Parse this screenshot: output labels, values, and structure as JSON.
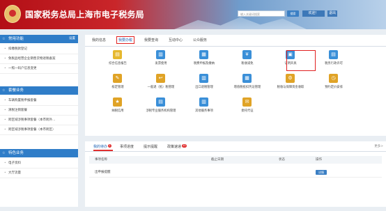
{
  "header": {
    "title": "国家税务总局上海市电子税务局",
    "search_placeholder": "输入关键词搜索",
    "search_button": "搜索",
    "welcome": "欢迎！",
    "exit": "退出"
  },
  "sidebar": {
    "common": {
      "title": "常用功能",
      "settings": "设置",
      "items": [
        "扣缴税款登记",
        "免税品经营企业销售货物退税备案",
        "一照一码户信息变更"
      ]
    },
    "vehicle": {
      "title": "套餐业务",
      "items": [
        "车辆购置税申报套餐",
        "清税注销套餐",
        "跨区域涉税事项套餐（本市跨外…",
        "跨区域涉税事项套餐（本市跨区）"
      ]
    },
    "special": {
      "title": "特色业务",
      "items": [
        "电子资料",
        "大厅流量"
      ]
    }
  },
  "main_tabs": [
    "我的信息",
    "我要办税",
    "我要查询",
    "互动中心",
    "公众服务"
  ],
  "functions": [
    {
      "label": "综合信息报告",
      "color": "#e6b82e",
      "glyph": "▤"
    },
    {
      "label": "发票使用",
      "color": "#3a8fd8",
      "glyph": "▥"
    },
    {
      "label": "税费申报及缴纳",
      "color": "#3a8fd8",
      "glyph": "▦"
    },
    {
      "label": "税收减免",
      "color": "#3a8fd8",
      "glyph": "¥"
    },
    {
      "label": "证明开具",
      "color": "#3a8fd8",
      "glyph": "▣"
    },
    {
      "label": "税务行政许可",
      "color": "#3a8fd8",
      "glyph": "▤"
    },
    {
      "label": "核定管理",
      "color": "#e0a326",
      "glyph": "✎"
    },
    {
      "label": "一般退（抵）税管理",
      "color": "#e0a326",
      "glyph": "↩"
    },
    {
      "label": "出口退税管理",
      "color": "#3a8fd8",
      "glyph": "▥"
    },
    {
      "label": "增值税抵扣凭证管理",
      "color": "#3a8fd8",
      "glyph": "▦"
    },
    {
      "label": "税收与保障资金收取",
      "color": "#e0a326",
      "glyph": "⚙"
    },
    {
      "label": "预约定价安排",
      "color": "#e0a326",
      "glyph": "◷"
    },
    {
      "label": "纳税信用",
      "color": "#e0a326",
      "glyph": "★"
    },
    {
      "label": "涉税专业服务机构管理",
      "color": "#3a8fd8",
      "glyph": "▤"
    },
    {
      "label": "其他服务事项",
      "color": "#3a8fd8",
      "glyph": "▥"
    },
    {
      "label": "委托代征",
      "color": "#e0a326",
      "glyph": "✉"
    }
  ],
  "todo": {
    "tabs": [
      "我的待办",
      "事项进度",
      "提示提醒",
      "政策速递"
    ],
    "badges": [
      "1",
      "",
      "",
      "10"
    ],
    "more": "更多>",
    "columns": [
      "事项名称",
      "截止日期",
      "状态",
      "操作"
    ],
    "rows": [
      {
        "name": "出申报提醒",
        "date": "",
        "status": "",
        "action": "详情"
      }
    ]
  },
  "colors": {
    "accent": "#2f7dc8",
    "highlight": "#e02020",
    "header_red": "#b30f16"
  }
}
